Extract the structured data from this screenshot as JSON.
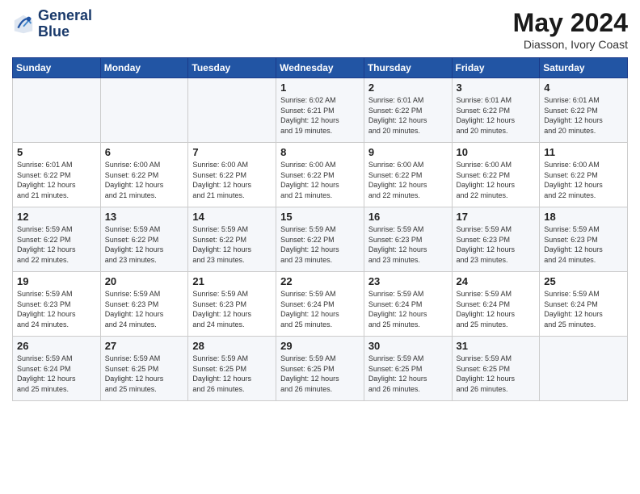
{
  "header": {
    "logo_line1": "General",
    "logo_line2": "Blue",
    "title": "May 2024",
    "subtitle": "Diasson, Ivory Coast"
  },
  "days_of_week": [
    "Sunday",
    "Monday",
    "Tuesday",
    "Wednesday",
    "Thursday",
    "Friday",
    "Saturday"
  ],
  "weeks": [
    [
      {
        "day": "",
        "info": ""
      },
      {
        "day": "",
        "info": ""
      },
      {
        "day": "",
        "info": ""
      },
      {
        "day": "1",
        "info": "Sunrise: 6:02 AM\nSunset: 6:21 PM\nDaylight: 12 hours\nand 19 minutes."
      },
      {
        "day": "2",
        "info": "Sunrise: 6:01 AM\nSunset: 6:22 PM\nDaylight: 12 hours\nand 20 minutes."
      },
      {
        "day": "3",
        "info": "Sunrise: 6:01 AM\nSunset: 6:22 PM\nDaylight: 12 hours\nand 20 minutes."
      },
      {
        "day": "4",
        "info": "Sunrise: 6:01 AM\nSunset: 6:22 PM\nDaylight: 12 hours\nand 20 minutes."
      }
    ],
    [
      {
        "day": "5",
        "info": "Sunrise: 6:01 AM\nSunset: 6:22 PM\nDaylight: 12 hours\nand 21 minutes."
      },
      {
        "day": "6",
        "info": "Sunrise: 6:00 AM\nSunset: 6:22 PM\nDaylight: 12 hours\nand 21 minutes."
      },
      {
        "day": "7",
        "info": "Sunrise: 6:00 AM\nSunset: 6:22 PM\nDaylight: 12 hours\nand 21 minutes."
      },
      {
        "day": "8",
        "info": "Sunrise: 6:00 AM\nSunset: 6:22 PM\nDaylight: 12 hours\nand 21 minutes."
      },
      {
        "day": "9",
        "info": "Sunrise: 6:00 AM\nSunset: 6:22 PM\nDaylight: 12 hours\nand 22 minutes."
      },
      {
        "day": "10",
        "info": "Sunrise: 6:00 AM\nSunset: 6:22 PM\nDaylight: 12 hours\nand 22 minutes."
      },
      {
        "day": "11",
        "info": "Sunrise: 6:00 AM\nSunset: 6:22 PM\nDaylight: 12 hours\nand 22 minutes."
      }
    ],
    [
      {
        "day": "12",
        "info": "Sunrise: 5:59 AM\nSunset: 6:22 PM\nDaylight: 12 hours\nand 22 minutes."
      },
      {
        "day": "13",
        "info": "Sunrise: 5:59 AM\nSunset: 6:22 PM\nDaylight: 12 hours\nand 23 minutes."
      },
      {
        "day": "14",
        "info": "Sunrise: 5:59 AM\nSunset: 6:22 PM\nDaylight: 12 hours\nand 23 minutes."
      },
      {
        "day": "15",
        "info": "Sunrise: 5:59 AM\nSunset: 6:22 PM\nDaylight: 12 hours\nand 23 minutes."
      },
      {
        "day": "16",
        "info": "Sunrise: 5:59 AM\nSunset: 6:23 PM\nDaylight: 12 hours\nand 23 minutes."
      },
      {
        "day": "17",
        "info": "Sunrise: 5:59 AM\nSunset: 6:23 PM\nDaylight: 12 hours\nand 23 minutes."
      },
      {
        "day": "18",
        "info": "Sunrise: 5:59 AM\nSunset: 6:23 PM\nDaylight: 12 hours\nand 24 minutes."
      }
    ],
    [
      {
        "day": "19",
        "info": "Sunrise: 5:59 AM\nSunset: 6:23 PM\nDaylight: 12 hours\nand 24 minutes."
      },
      {
        "day": "20",
        "info": "Sunrise: 5:59 AM\nSunset: 6:23 PM\nDaylight: 12 hours\nand 24 minutes."
      },
      {
        "day": "21",
        "info": "Sunrise: 5:59 AM\nSunset: 6:23 PM\nDaylight: 12 hours\nand 24 minutes."
      },
      {
        "day": "22",
        "info": "Sunrise: 5:59 AM\nSunset: 6:24 PM\nDaylight: 12 hours\nand 25 minutes."
      },
      {
        "day": "23",
        "info": "Sunrise: 5:59 AM\nSunset: 6:24 PM\nDaylight: 12 hours\nand 25 minutes."
      },
      {
        "day": "24",
        "info": "Sunrise: 5:59 AM\nSunset: 6:24 PM\nDaylight: 12 hours\nand 25 minutes."
      },
      {
        "day": "25",
        "info": "Sunrise: 5:59 AM\nSunset: 6:24 PM\nDaylight: 12 hours\nand 25 minutes."
      }
    ],
    [
      {
        "day": "26",
        "info": "Sunrise: 5:59 AM\nSunset: 6:24 PM\nDaylight: 12 hours\nand 25 minutes."
      },
      {
        "day": "27",
        "info": "Sunrise: 5:59 AM\nSunset: 6:25 PM\nDaylight: 12 hours\nand 25 minutes."
      },
      {
        "day": "28",
        "info": "Sunrise: 5:59 AM\nSunset: 6:25 PM\nDaylight: 12 hours\nand 26 minutes."
      },
      {
        "day": "29",
        "info": "Sunrise: 5:59 AM\nSunset: 6:25 PM\nDaylight: 12 hours\nand 26 minutes."
      },
      {
        "day": "30",
        "info": "Sunrise: 5:59 AM\nSunset: 6:25 PM\nDaylight: 12 hours\nand 26 minutes."
      },
      {
        "day": "31",
        "info": "Sunrise: 5:59 AM\nSunset: 6:25 PM\nDaylight: 12 hours\nand 26 minutes."
      },
      {
        "day": "",
        "info": ""
      }
    ]
  ]
}
